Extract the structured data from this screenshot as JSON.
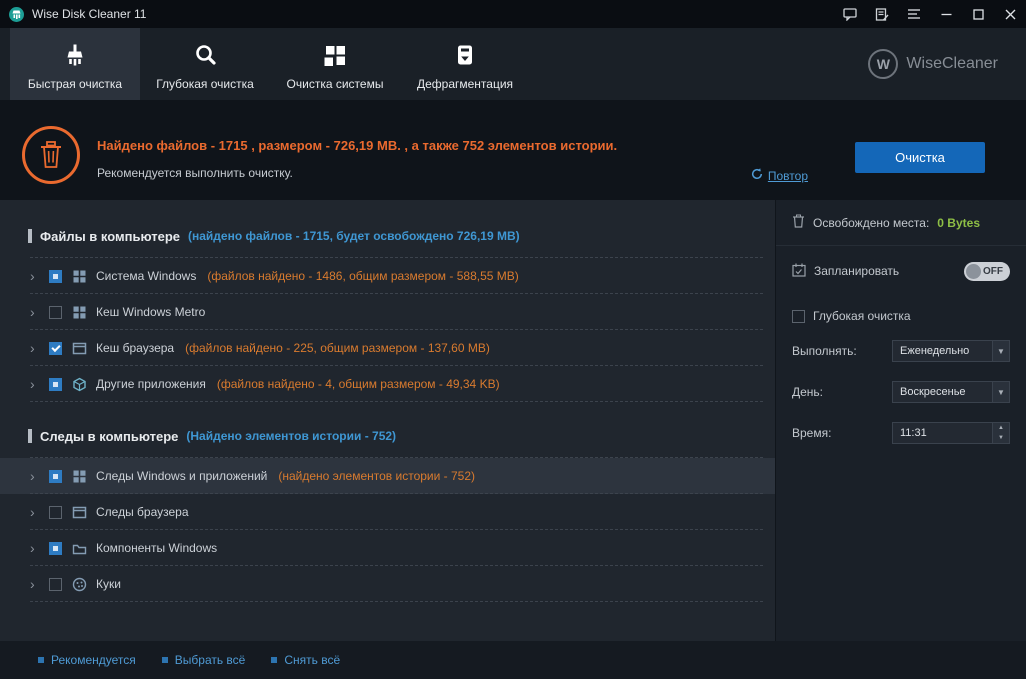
{
  "titlebar": {
    "title": "Wise Disk Cleaner 11"
  },
  "nav": {
    "tabs": [
      {
        "label": "Быстрая очистка"
      },
      {
        "label": "Глубокая очистка"
      },
      {
        "label": "Очистка системы"
      },
      {
        "label": "Дефрагментация"
      }
    ],
    "brand_letter": "W",
    "brand": "WiseCleaner"
  },
  "summary": {
    "headline": "Найдено файлов - 1715 , размером - 726,19 МВ. , а также 752 элементов истории.",
    "subline": "Рекомендуется выполнить очистку.",
    "repeat_label": "Повтор",
    "clean_button": "Очистка"
  },
  "tree": {
    "sections": [
      {
        "title": "Файлы в компьютере",
        "annotation": "(найдено файлов - 1715, будет освобождено 726,19 MB)",
        "items": [
          {
            "label": "Система Windows",
            "annotation": "(файлов найдено - 1486, общим размером - 588,55 MB)",
            "state": "partial",
            "row_state": "normal",
            "icon": "windows-system-icon"
          },
          {
            "label": "Кеш Windows Metro",
            "annotation": "",
            "state": "unchecked",
            "row_state": "normal",
            "icon": "metro-cache-icon"
          },
          {
            "label": "Кеш браузера",
            "annotation": "(файлов найдено - 225, общим размером - 137,60 MB)",
            "state": "checked",
            "row_state": "normal",
            "icon": "browser-cache-icon"
          },
          {
            "label": "Другие приложения",
            "annotation": "(файлов найдено - 4, общим размером - 49,34 KB)",
            "state": "partial",
            "row_state": "normal",
            "icon": "other-apps-icon"
          }
        ]
      },
      {
        "title": "Следы в компьютере",
        "annotation": "(Найдено элементов истории - 752)",
        "items": [
          {
            "label": "Следы Windows и приложений",
            "annotation": "(найдено элементов истории - 752)",
            "state": "partial",
            "row_state": "selected",
            "icon": "windows-traces-icon"
          },
          {
            "label": "Следы браузера",
            "annotation": "",
            "state": "unchecked",
            "row_state": "normal",
            "icon": "browser-traces-icon"
          },
          {
            "label": "Компоненты Windows",
            "annotation": "",
            "state": "partial",
            "row_state": "normal",
            "icon": "windows-components-icon"
          },
          {
            "label": "Куки",
            "annotation": "",
            "state": "unchecked",
            "row_state": "normal",
            "icon": "cookies-icon"
          }
        ]
      }
    ]
  },
  "sidebar": {
    "freed_label": "Освобождено места:",
    "freed_value": "0 Bytes",
    "schedule_label": "Запланировать",
    "toggle_state": "OFF",
    "deep_clean_label": "Глубокая очистка",
    "run_label": "Выполнять:",
    "run_value": "Еженедельно",
    "day_label": "День:",
    "day_value": "Воскресенье",
    "time_label": "Время:",
    "time_value": "11:31"
  },
  "footer": {
    "links": [
      {
        "label": "Рекомендуется"
      },
      {
        "label": "Выбрать всё"
      },
      {
        "label": "Снять всё"
      }
    ]
  },
  "colors": {
    "accent_orange": "#ea6a2f",
    "annotation_orange": "#d97b2f",
    "accent_blue": "#3f97d3",
    "button_blue": "#1467b8",
    "freed_green": "#8ebf45",
    "link_blue": "#4f9bd5"
  }
}
